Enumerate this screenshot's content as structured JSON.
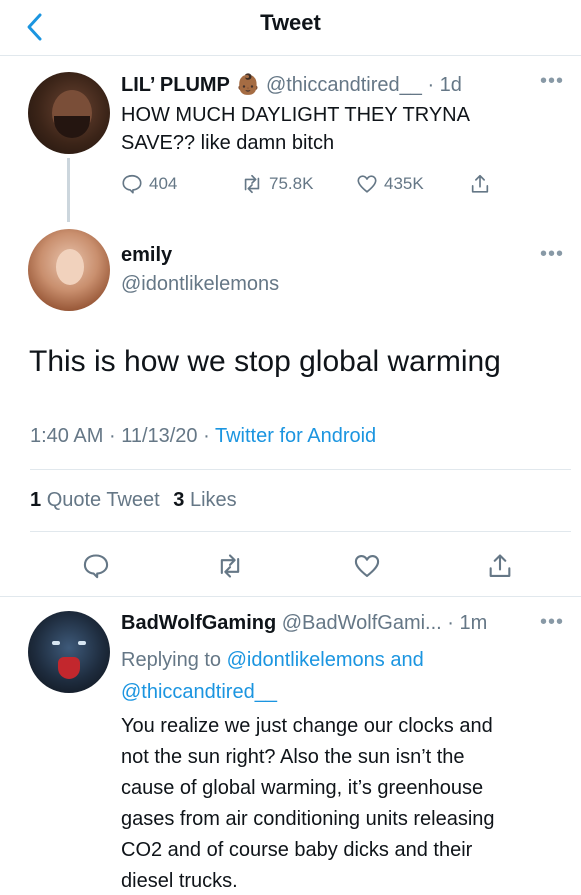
{
  "header": {
    "title": "Tweet"
  },
  "parent_tweet": {
    "display_name": "LIL’ PLUMP",
    "emoji": "👶🏾",
    "handle": "@thiccandtired__",
    "time": "· 1d",
    "text_line1": "HOW MUCH DAYLIGHT THEY TRYNA",
    "text_line2": "SAVE?? like damn bitch",
    "replies": "404",
    "retweets": "75.8K",
    "likes": "435K"
  },
  "main_tweet": {
    "display_name": "emily",
    "handle": "@idontlikelemons",
    "text": "This is how we stop global warming",
    "time": "1:40 AM",
    "date": "11/13/20",
    "source": "Twitter for Android",
    "quote_count": "1",
    "quote_label": "Quote Tweet",
    "like_count": "3",
    "like_label": "Likes"
  },
  "reply_tweet": {
    "display_name": "BadWolfGaming",
    "handle": "@BadWolfGami...",
    "time": "· 1m",
    "replying_prefix": "Replying to",
    "replying_to_1": "@idontlikelemons",
    "replying_and": "and",
    "replying_to_2": "@thiccandtired__",
    "text_lines": [
      "You realize we just change our clocks and",
      "not the sun right? Also the sun isn’t the",
      "cause of global warming, it’s greenhouse",
      "gases from air conditioning units releasing",
      "CO2 and of course baby dicks and their",
      "diesel trucks."
    ]
  },
  "icons": {
    "back": "chevron-left-icon",
    "reply": "reply-icon",
    "retweet": "retweet-icon",
    "like": "heart-icon",
    "share": "share-icon",
    "more": "more-icon"
  },
  "colors": {
    "accent": "#1b95e0",
    "muted": "#657786",
    "divider": "#e1e8ed"
  }
}
